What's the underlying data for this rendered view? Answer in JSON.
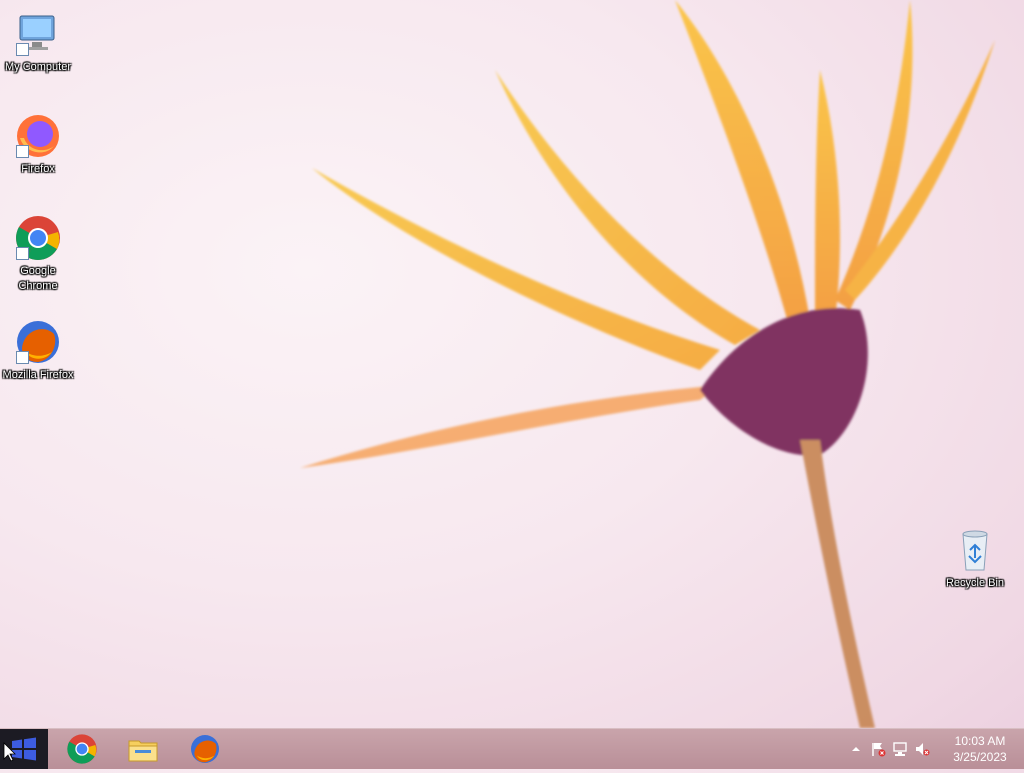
{
  "desktop": {
    "icons": [
      {
        "id": "my-computer",
        "label": "My Computer"
      },
      {
        "id": "firefox",
        "label": "Firefox"
      },
      {
        "id": "google-chrome",
        "label": "Google Chrome"
      },
      {
        "id": "mozilla-firefox",
        "label": "Mozilla Firefox"
      },
      {
        "id": "recycle-bin",
        "label": "Recycle Bin"
      }
    ]
  },
  "taskbar": {
    "start_icon": "windows-logo-icon",
    "pinned": [
      {
        "name": "Google Chrome",
        "icon": "chrome-icon"
      },
      {
        "name": "File Explorer",
        "icon": "folder-icon"
      },
      {
        "name": "Mozilla Firefox",
        "icon": "firefox-icon"
      }
    ],
    "tray": {
      "icons": [
        "show-hidden-icons-arrow",
        "action-center-flag-icon",
        "network-icon",
        "volume-muted-icon"
      ],
      "time": "10:03 AM",
      "date": "3/25/2023"
    }
  },
  "colors": {
    "taskbar": "#b98f98",
    "start": "#1c1b23",
    "accent": "#2f6ee0"
  }
}
